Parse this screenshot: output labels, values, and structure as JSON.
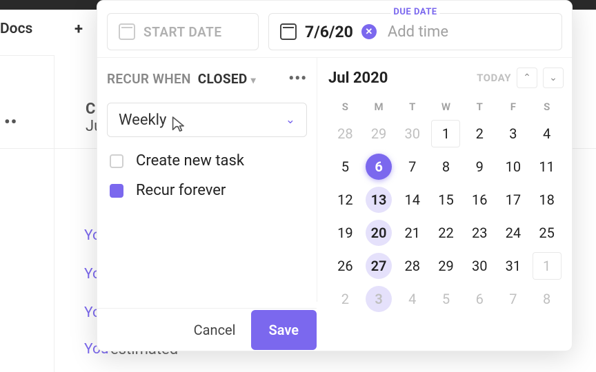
{
  "bg": {
    "docs": "Docs",
    "plus": "+",
    "dots": "••",
    "c_letter": "C",
    "ju": "Ju",
    "you1": "Yo",
    "you2": "Yo",
    "you3": "Yo",
    "you4": "You",
    "tail": "estimated"
  },
  "header": {
    "start_placeholder": "START DATE",
    "due_label": "DUE DATE",
    "due_value": "7/6/20",
    "add_time": "Add time"
  },
  "recur": {
    "prefix": "RECUR WHEN",
    "state": "CLOSED",
    "frequency": "Weekly",
    "create_new_task_label": "Create new task",
    "create_new_task_checked": false,
    "recur_forever_label": "Recur forever",
    "recur_forever_checked": true
  },
  "calendar": {
    "month_label": "Jul 2020",
    "today_label": "TODAY",
    "dow": [
      "S",
      "M",
      "T",
      "W",
      "T",
      "F",
      "S"
    ],
    "weeks": [
      [
        {
          "d": "28",
          "other": true
        },
        {
          "d": "29",
          "other": true
        },
        {
          "d": "30",
          "other": true
        },
        {
          "d": "1",
          "boxed": true
        },
        {
          "d": "2"
        },
        {
          "d": "3"
        },
        {
          "d": "4"
        }
      ],
      [
        {
          "d": "5"
        },
        {
          "d": "6",
          "selected": true
        },
        {
          "d": "7"
        },
        {
          "d": "8"
        },
        {
          "d": "9"
        },
        {
          "d": "10"
        },
        {
          "d": "11"
        }
      ],
      [
        {
          "d": "12"
        },
        {
          "d": "13",
          "highlight": true
        },
        {
          "d": "14"
        },
        {
          "d": "15"
        },
        {
          "d": "16"
        },
        {
          "d": "17"
        },
        {
          "d": "18"
        }
      ],
      [
        {
          "d": "19"
        },
        {
          "d": "20",
          "highlight": true
        },
        {
          "d": "21"
        },
        {
          "d": "22"
        },
        {
          "d": "23"
        },
        {
          "d": "24"
        },
        {
          "d": "25"
        }
      ],
      [
        {
          "d": "26"
        },
        {
          "d": "27",
          "highlight": true
        },
        {
          "d": "28"
        },
        {
          "d": "29"
        },
        {
          "d": "30"
        },
        {
          "d": "31"
        },
        {
          "d": "1",
          "other": true,
          "boxed": true
        }
      ],
      [
        {
          "d": "2",
          "other": true
        },
        {
          "d": "3",
          "other": true,
          "highlight": true
        },
        {
          "d": "4",
          "other": true
        },
        {
          "d": "5",
          "other": true
        },
        {
          "d": "6",
          "other": true
        },
        {
          "d": "7",
          "other": true
        },
        {
          "d": "8",
          "other": true
        }
      ]
    ]
  },
  "footer": {
    "cancel": "Cancel",
    "save": "Save"
  }
}
